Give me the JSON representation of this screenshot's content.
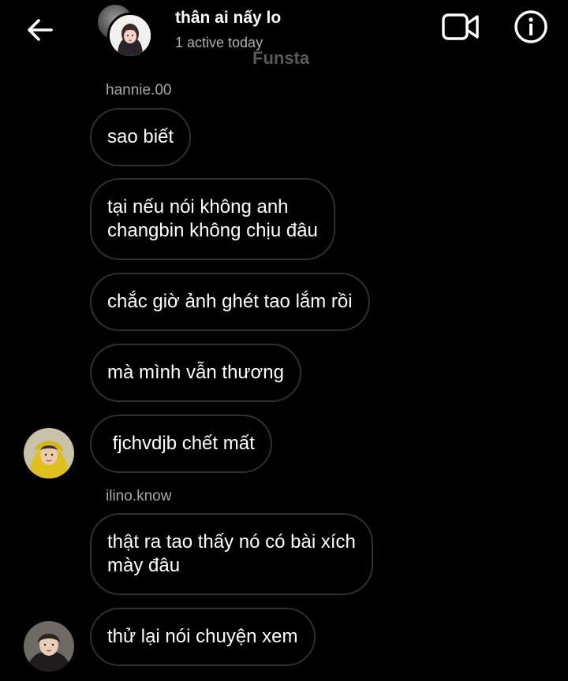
{
  "header": {
    "title": "thân ai nấy lo",
    "status": "1 active today",
    "watermark": "Funsta",
    "back_icon": "arrow-left-icon",
    "video_icon": "video-camera-icon",
    "info_icon": "info-icon"
  },
  "messages": [
    {
      "sender": "hannie.00",
      "text": "sao biết"
    },
    {
      "text": "tại nếu nói không anh\nchangbin không chịu đâu"
    },
    {
      "text": "chắc giờ ảnh ghét tao lắm rồi"
    },
    {
      "text": "mà mình vẫn thương"
    },
    {
      "text": " fjchvdjb chết mất"
    },
    {
      "sender": "ilino.know",
      "text": "thật ra tao thấy nó có bài xích\nmày đâu"
    },
    {
      "text": "thử lại nói chuyện xem"
    }
  ],
  "colors": {
    "background": "#000000",
    "bubble_border": "#2f2f2f",
    "sender_text": "#a8a8a8",
    "watermark": "#5a5a5a",
    "avatar_yellow": "#e0c020"
  }
}
